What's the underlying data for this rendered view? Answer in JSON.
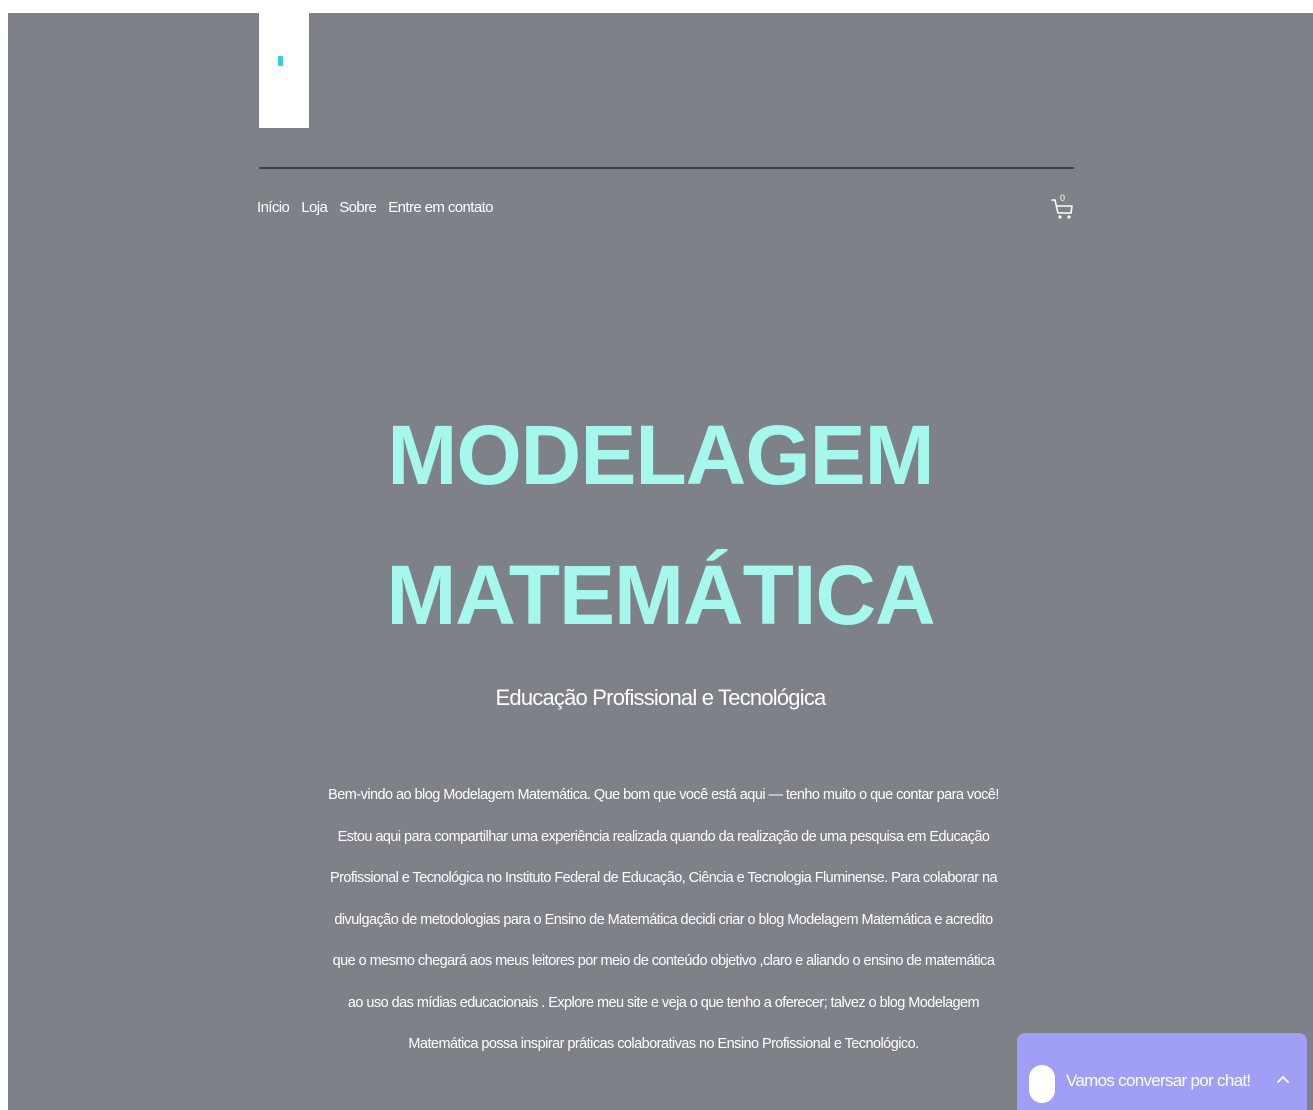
{
  "header": {
    "logo_icon": "logo-mark",
    "nav": [
      {
        "label": "Início"
      },
      {
        "label": "Loja"
      },
      {
        "label": "Sobre"
      },
      {
        "label": "Entre em contato"
      }
    ],
    "cart": {
      "icon": "cart-icon",
      "count": "0"
    }
  },
  "hero": {
    "title_line1": "MODELAGEM",
    "title_line2": "MATEMÁTICA",
    "subtitle": "Educação Profissional e Tecnológica",
    "body": "Bem-vindo ao blog Modelagem Matemática. Que bom que você está aqui — tenho muito o que contar para você! Estou aqui para compartilhar uma experiência realizada quando da realização de uma pesquisa em Educação Profissional e Tecnológica no Instituto Federal de Educação, Ciência e Tecnologia Fluminense. Para colaborar na divulgação de metodologias para o Ensino de Matemática decidi criar  o blog Modelagem Matemática e acredito que o mesmo chegará aos meus leitores por meio de conteúdo objetivo ,claro e aliando o ensino de matemática  ao uso das mídias educacionais . Explore meu site e veja o que tenho a oferecer; talvez o blog Modelagem Matemática possa inspirar práticas colaborativas no Ensino Profissional e Tecnológico."
  },
  "chat": {
    "label": "Vamos conversar por chat!",
    "icon": "chevron-up-icon"
  },
  "colors": {
    "background": "#7f8189",
    "title": "#a6f7ec",
    "chat": "#a19ff5",
    "divider": "#3b3f48",
    "logo_accent": "#2fd0df"
  }
}
